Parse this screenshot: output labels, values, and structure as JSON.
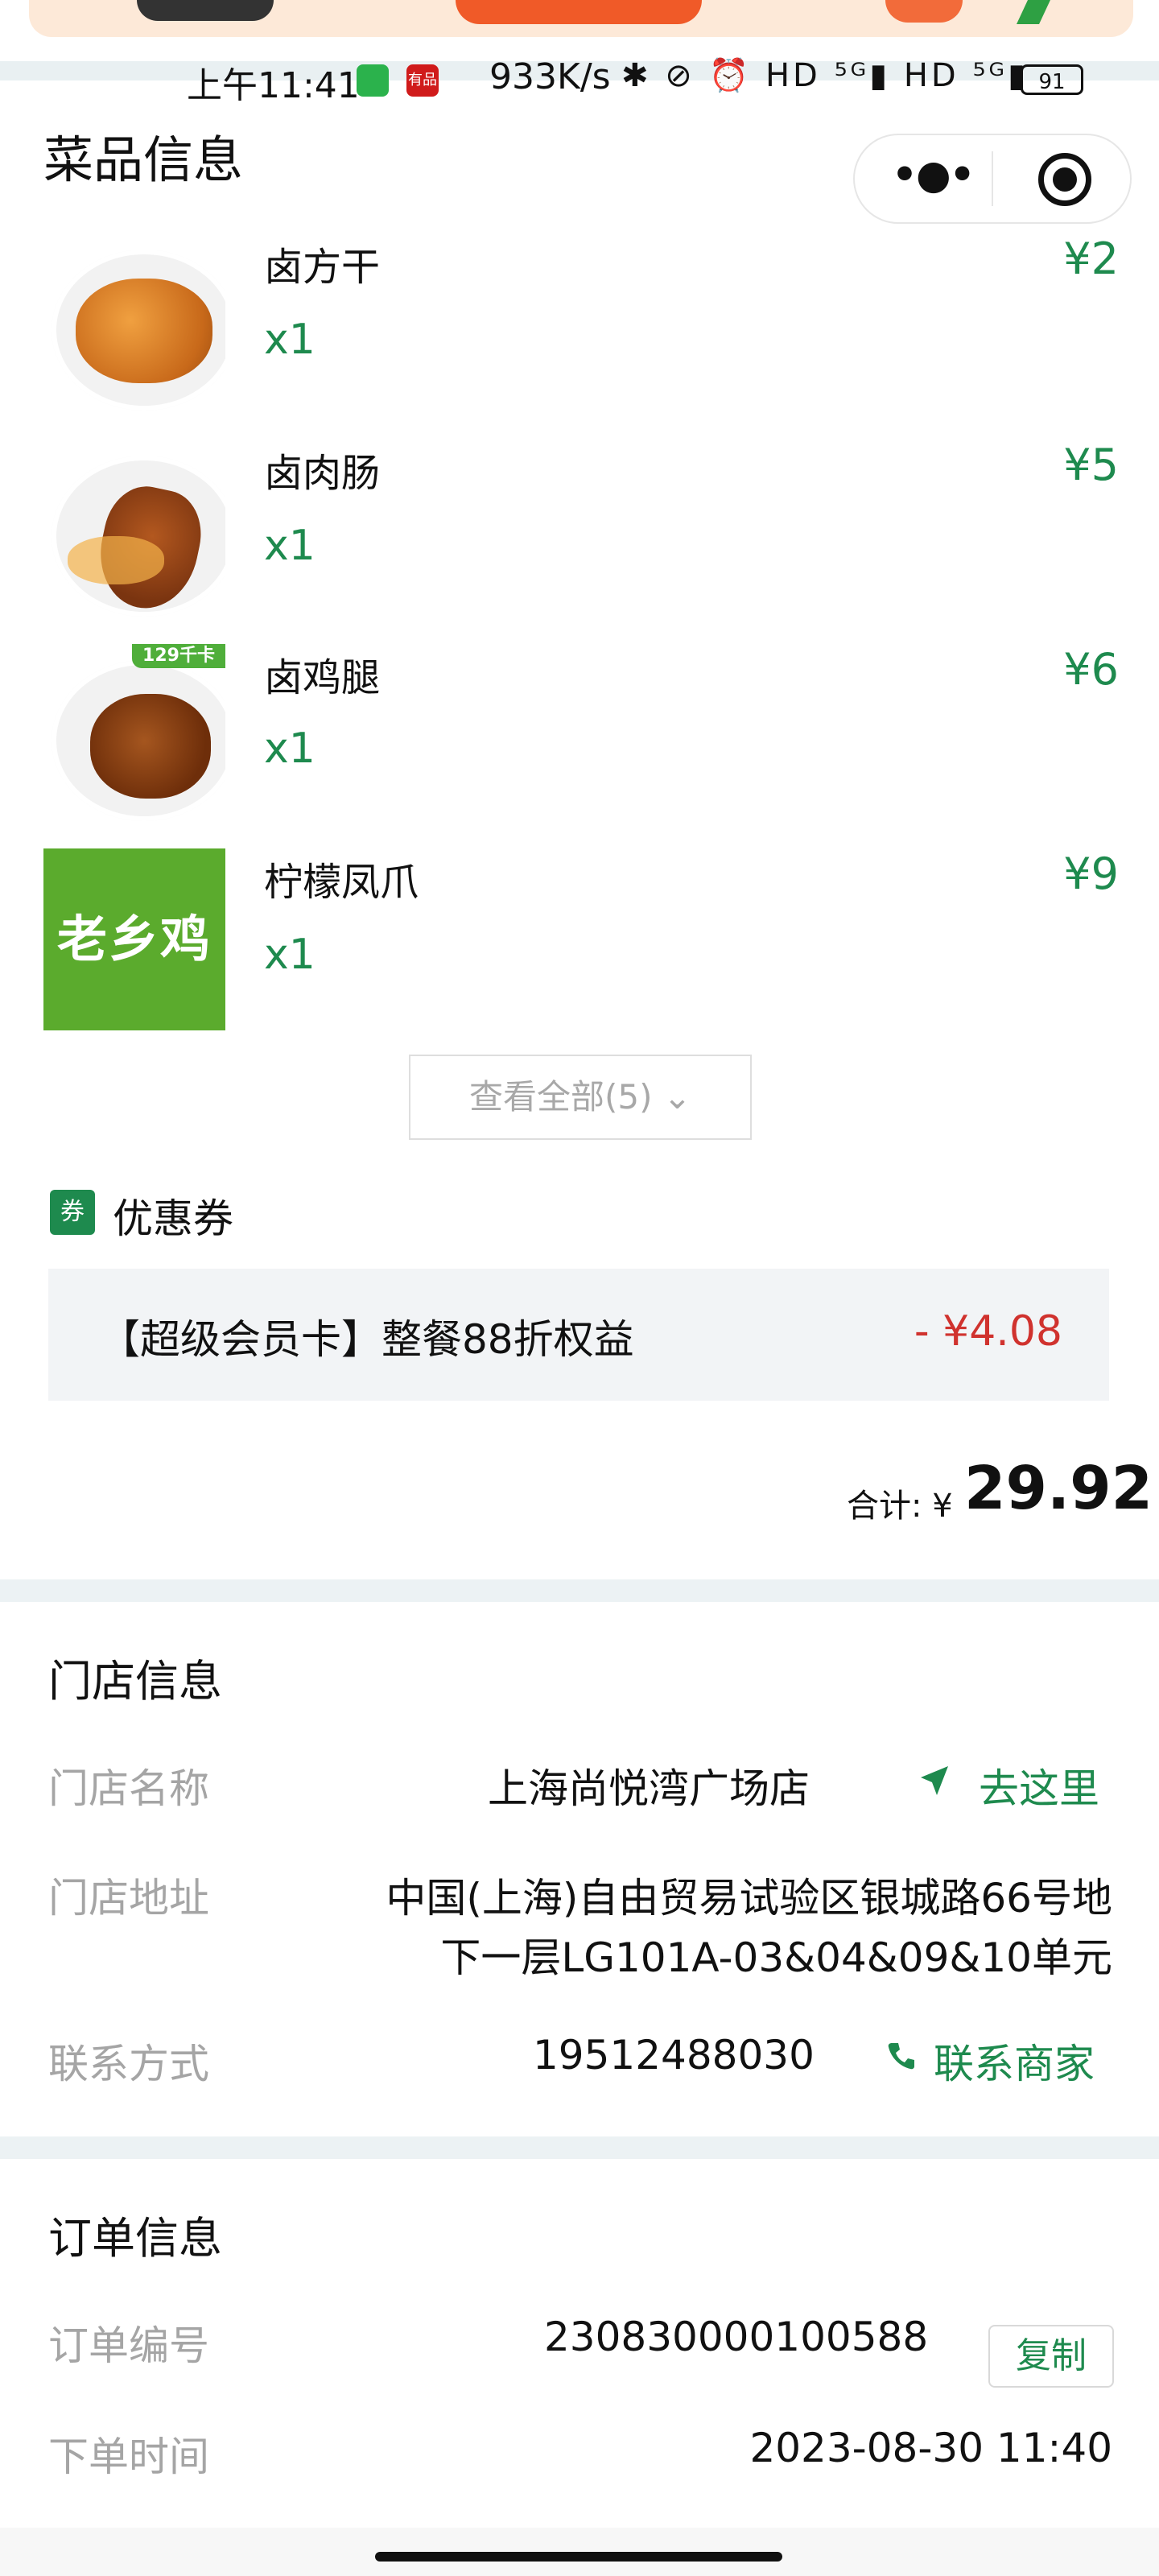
{
  "status_bar": {
    "time": "上午11:41",
    "app_icon_text": "有品",
    "net_speed": "933K/s",
    "signal_icons": "✱ ⊘ ⏰ HD ⁵ᴳ▮ HD ⁵ᴳ▮",
    "battery": "91"
  },
  "header": {
    "title": "菜品信息",
    "capsule_more": "•●•"
  },
  "dishes": [
    {
      "name": "卤方干",
      "qty": "x1",
      "price": "¥2",
      "image": "braised-tofu-image"
    },
    {
      "name": "卤肉肠",
      "qty": "x1",
      "price": "¥5",
      "image": "braised-sausage-image"
    },
    {
      "name": "卤鸡腿",
      "qty": "x1",
      "price": "¥6",
      "image": "braised-chicken-leg-image",
      "tag": "129千卡"
    },
    {
      "name": "柠檬凤爪",
      "qty": "x1",
      "price": "¥9",
      "image": "brand-logo-image",
      "logo_text": "老乡鸡"
    }
  ],
  "view_all": "查看全部(5) ⌄",
  "coupon": {
    "icon_text": "券",
    "title": "优惠券",
    "item_text": "【超级会员卡】整餐88折权益",
    "amount": "- ¥4.08"
  },
  "total": {
    "label": "合计: ¥",
    "value": "29.92"
  },
  "store": {
    "section_title": "门店信息",
    "name_label": "门店名称",
    "name_value": "上海尚悦湾广场店",
    "navigate_icon": "navigation-arrow-icon",
    "navigate_label": "去这里",
    "address_label": "门店地址",
    "address_line1": "中国(上海)自由贸易试验区银城路66号地",
    "address_line2": "下一层LG101A-03&04&09&10单元",
    "contact_label": "联系方式",
    "contact_value": "19512488030",
    "contact_icon": "phone-icon",
    "contact_action": "联系商家"
  },
  "order": {
    "section_title": "订单信息",
    "number_label": "订单编号",
    "number_value": "230830000100588",
    "copy_label": "复制",
    "time_label": "下单时间",
    "time_value": "2023-08-30 11:40"
  },
  "colors": {
    "accent_green": "#1e8a4e",
    "discount_red": "#d0322e",
    "divider": "#ecf2f4"
  }
}
